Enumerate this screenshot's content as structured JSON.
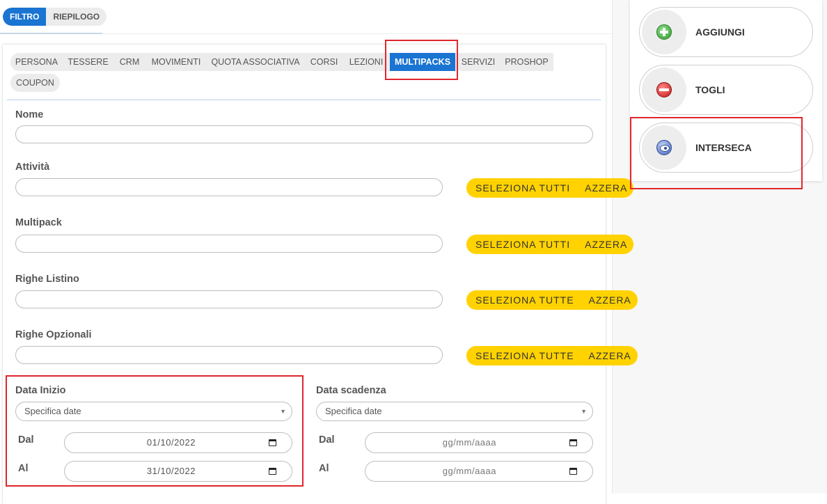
{
  "top_toggle": {
    "filtro": "FILTRO",
    "riepilogo": "RIEPILOGO"
  },
  "tabs": [
    {
      "label": "PERSONA"
    },
    {
      "label": "TESSERE"
    },
    {
      "label": "CRM"
    },
    {
      "label": "MOVIMENTI"
    },
    {
      "label": "QUOTA ASSOCIATIVA"
    },
    {
      "label": "CORSI"
    },
    {
      "label": "LEZIONI"
    },
    {
      "label": "MULTIPACKS"
    },
    {
      "label": "SERVIZI"
    },
    {
      "label": "PROSHOP"
    },
    {
      "label": "COUPON"
    }
  ],
  "active_tab": "MULTIPACKS",
  "fields": {
    "nome": {
      "label": "Nome",
      "value": ""
    },
    "attivita": {
      "label": "Attività",
      "value": "",
      "select_all": "SELEZIONA TUTTI",
      "reset": "AZZERA"
    },
    "multipack": {
      "label": "Multipack",
      "value": "",
      "select_all": "SELEZIONA TUTTI",
      "reset": "AZZERA"
    },
    "righe_listino": {
      "label": "Righe Listino",
      "value": "",
      "select_all": "SELEZIONA TUTTE",
      "reset": "AZZERA"
    },
    "righe_opzionali": {
      "label": "Righe Opzionali",
      "value": "",
      "select_all": "SELEZIONA TUTTE",
      "reset": "AZZERA"
    }
  },
  "data_inizio": {
    "label": "Data Inizio",
    "select": "Specifica date",
    "dal_label": "Dal",
    "dal_value": "01/10/2022",
    "al_label": "Al",
    "al_value": "31/10/2022"
  },
  "data_scadenza": {
    "label": "Data scadenza",
    "select": "Specifica date",
    "dal_label": "Dal",
    "dal_value": "gg/mm/aaaa",
    "al_label": "Al",
    "al_value": "gg/mm/aaaa"
  },
  "operations": {
    "aggiungi": "AGGIUNGI",
    "togli": "TOGLI",
    "interseca": "INTERSECA"
  },
  "icons": {
    "plus": "plus-circle-icon",
    "minus": "minus-circle-icon",
    "intersect": "intersect-icon",
    "calendar": "calendar-icon",
    "dropdown": "chevron-down-icon"
  },
  "colors": {
    "primary_blue": "#1a74d2",
    "yellow": "#ffd200",
    "highlight_red": "#e0262d"
  }
}
